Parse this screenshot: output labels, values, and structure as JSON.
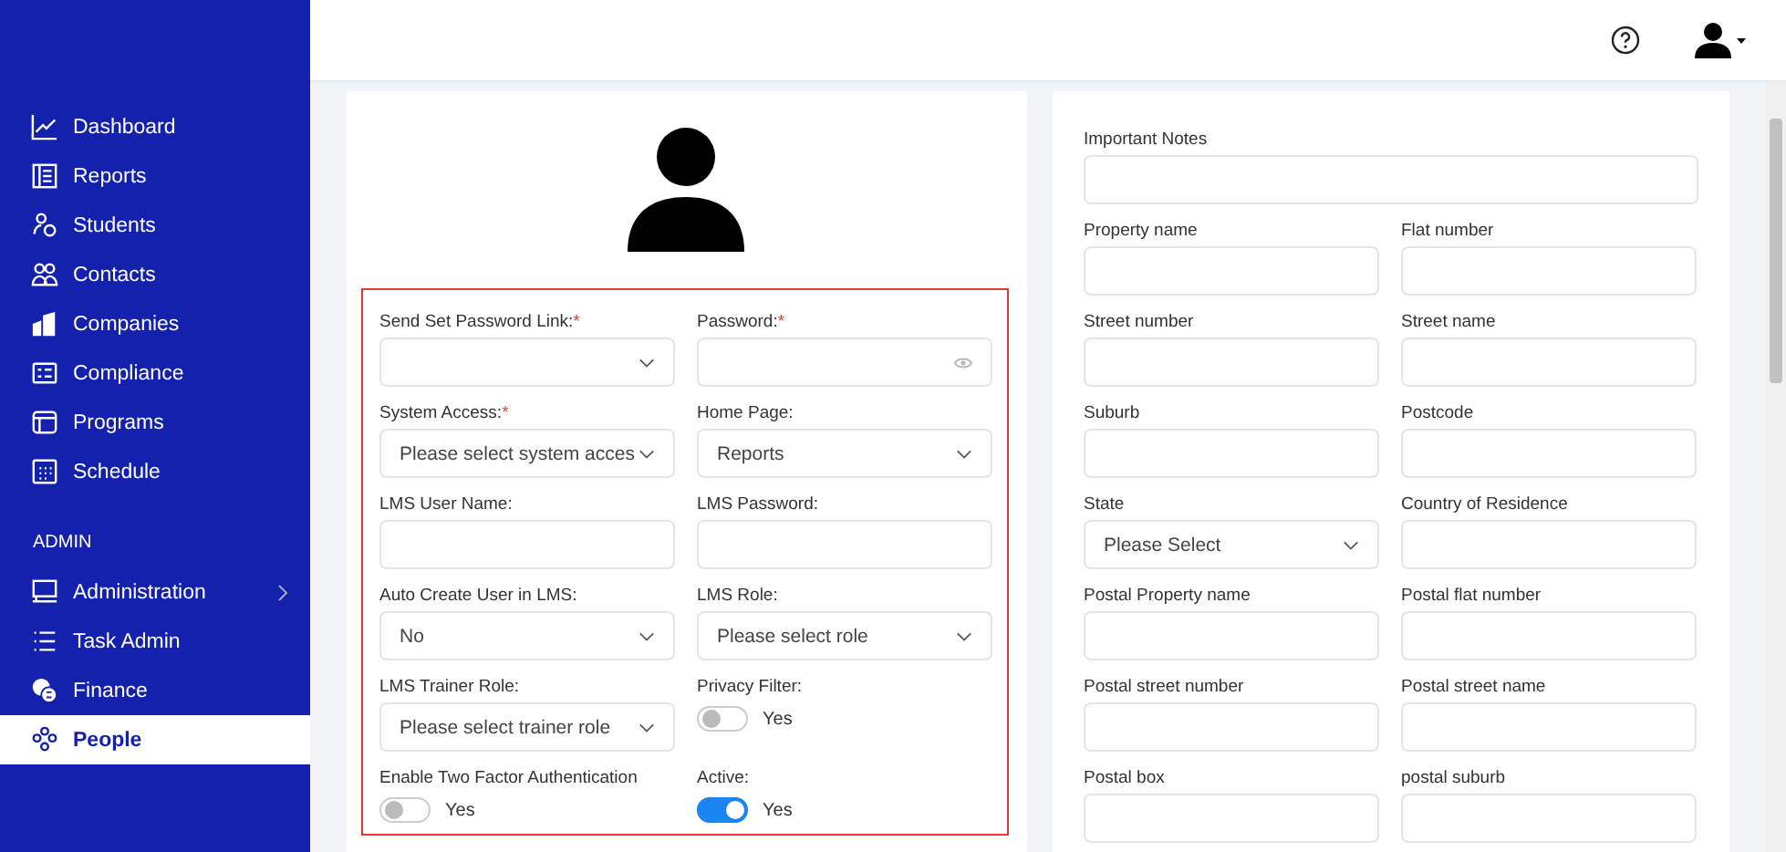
{
  "sidebar": {
    "items": [
      {
        "label": "Dashboard",
        "selected": false
      },
      {
        "label": "Reports",
        "selected": false
      },
      {
        "label": "Students",
        "selected": false
      },
      {
        "label": "Contacts",
        "selected": false
      },
      {
        "label": "Companies",
        "selected": false
      },
      {
        "label": "Compliance",
        "selected": false
      },
      {
        "label": "Programs",
        "selected": false
      },
      {
        "label": "Schedule",
        "selected": false
      }
    ],
    "section": "ADMIN",
    "admin_items": [
      {
        "label": "Administration",
        "selected": false,
        "expandable": true
      },
      {
        "label": "Task Admin",
        "selected": false,
        "expandable": false
      },
      {
        "label": "Finance",
        "selected": false,
        "expandable": false
      },
      {
        "label": "People",
        "selected": true,
        "expandable": false
      }
    ]
  },
  "account_form": {
    "fields": [
      {
        "kind": "select",
        "label": "Send Set Password Link:",
        "required_mark": "*"
      },
      {
        "kind": "password",
        "label": "Password:",
        "required_mark": "*"
      },
      {
        "kind": "select",
        "label": "System Access:",
        "required_mark": "*",
        "value": "Please select system acces"
      },
      {
        "kind": "select",
        "label": "Home Page:",
        "value": "Reports"
      },
      {
        "kind": "text",
        "label": "LMS User Name:"
      },
      {
        "kind": "text",
        "label": "LMS Password:"
      },
      {
        "kind": "select",
        "label": "Auto Create User in LMS:",
        "value": "No"
      },
      {
        "kind": "select",
        "label": "LMS Role:",
        "value": "Please select role"
      },
      {
        "kind": "select",
        "label": "LMS Trainer Role:",
        "value": "Please select trainer role"
      },
      {
        "kind": "toggle",
        "label": "Privacy Filter:",
        "on": false,
        "text": "Yes"
      },
      {
        "kind": "toggle",
        "label": "Enable Two Factor Authentication",
        "on": false,
        "text": "Yes"
      },
      {
        "kind": "toggle",
        "label": "Active:",
        "on": true,
        "text": "Yes"
      }
    ]
  },
  "address_form": {
    "notes": {
      "label": "Important Notes"
    },
    "fields": [
      {
        "kind": "text",
        "label": "Property name"
      },
      {
        "kind": "text",
        "label": "Flat number"
      },
      {
        "kind": "text",
        "label": "Street number"
      },
      {
        "kind": "text",
        "label": "Street name"
      },
      {
        "kind": "text",
        "label": "Suburb"
      },
      {
        "kind": "text",
        "label": "Postcode"
      },
      {
        "kind": "select",
        "label": "State",
        "value": "Please Select"
      },
      {
        "kind": "text",
        "label": "Country of Residence"
      },
      {
        "kind": "text",
        "label": "Postal Property name"
      },
      {
        "kind": "text",
        "label": "Postal flat number"
      },
      {
        "kind": "text",
        "label": "Postal street number"
      },
      {
        "kind": "text",
        "label": "Postal street name"
      },
      {
        "kind": "text",
        "label": "Postal box"
      },
      {
        "kind": "text",
        "label": "postal suburb"
      }
    ]
  }
}
